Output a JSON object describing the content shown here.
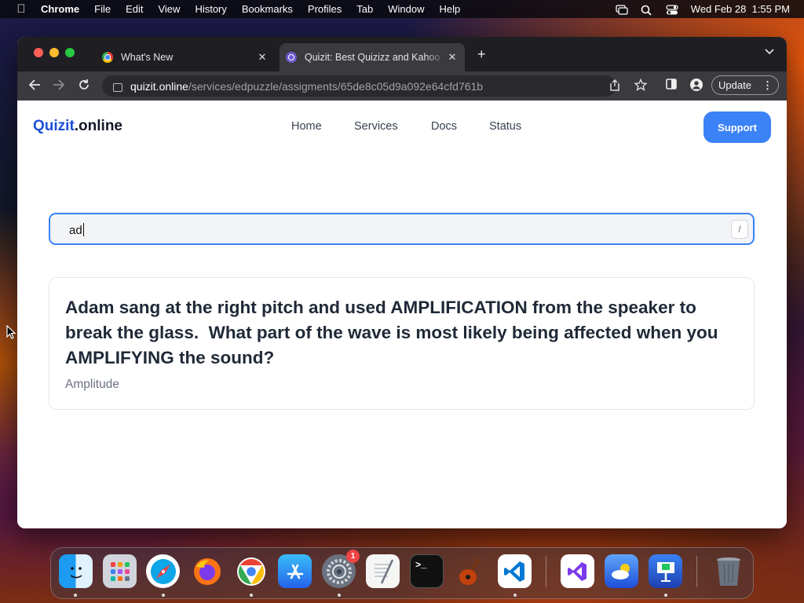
{
  "menubar": {
    "app": "Chrome",
    "items": [
      "File",
      "Edit",
      "View",
      "History",
      "Bookmarks",
      "Profiles",
      "Tab",
      "Window",
      "Help"
    ],
    "datetime": "Wed Feb 28  1:55 PM",
    "icons": [
      "apple-icon",
      "screen-mirroring-icon",
      "search-icon",
      "control-center-icon"
    ]
  },
  "browser": {
    "tabs": [
      {
        "title": "What's New",
        "favicon": "chrome-icon"
      },
      {
        "title": "Quizit: Best Quizizz and Kahoo",
        "favicon": "quizit-icon",
        "active": true
      }
    ],
    "url_host": "quizit.online",
    "url_path": "/services/edpuzzle/assigments/65de8c05d9a092e64cfd761b",
    "update_label": "Update"
  },
  "site": {
    "logo_part1": "Quizit",
    "logo_part2": ".online",
    "nav": [
      "Home",
      "Services",
      "Docs",
      "Status"
    ],
    "support_label": "Support",
    "search_value": "ad",
    "search_shortcut": "/",
    "results": [
      {
        "question": "Adam sang at the right pitch and used AMPLIFICATION from the speaker to break the glass.  What part of the wave is most likely being affected when you AMPLIFYING the sound?",
        "answer": "Amplitude"
      }
    ]
  },
  "dock": {
    "apps": [
      "Finder",
      "Launchpad",
      "Safari",
      "Firefox",
      "Chrome",
      "App Store",
      "System Settings",
      "TextEdit",
      "Terminal",
      "GarageBand",
      "Visual Studio Code",
      "Visual Studio",
      "Weather",
      "Keynote",
      "Trash"
    ],
    "settings_badge": "1"
  },
  "colors": {
    "accent": "#3b82f6",
    "logo_blue": "#1d4ed8"
  }
}
